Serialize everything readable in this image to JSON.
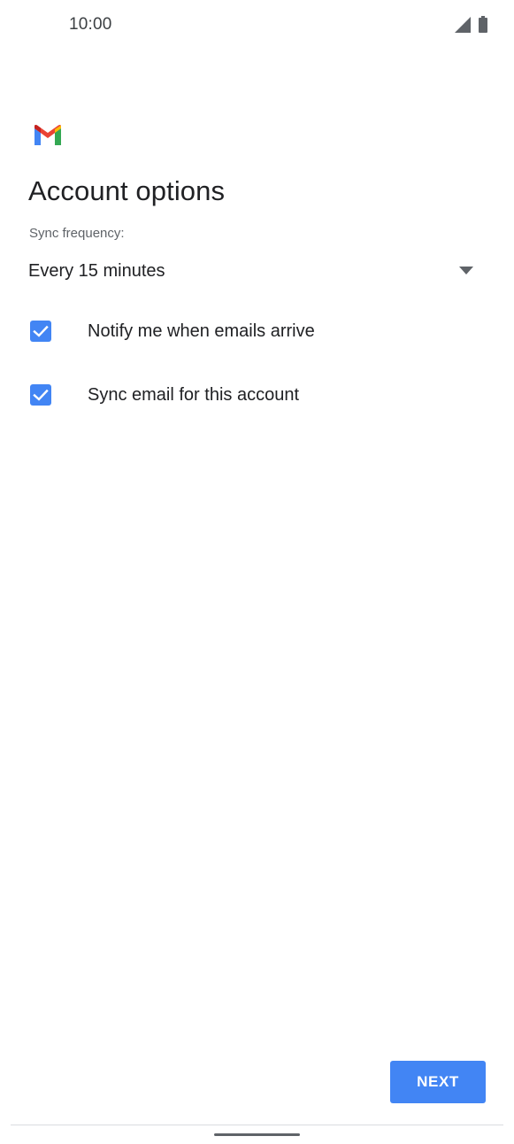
{
  "status_bar": {
    "time": "10:00",
    "icons": [
      "signal-icon",
      "battery-icon"
    ]
  },
  "header": {
    "logo_icon": "gmail-logo-icon",
    "title": "Account options"
  },
  "sync": {
    "label": "Sync frequency:",
    "selected": "Every 15 minutes"
  },
  "options": [
    {
      "label": "Notify me when emails arrive",
      "checked": true
    },
    {
      "label": "Sync email for this account",
      "checked": true
    }
  ],
  "actions": {
    "next_label": "NEXT"
  },
  "colors": {
    "accent": "#4285f4",
    "checkbox": "#4285f4",
    "text_primary": "#202124",
    "text_secondary": "#5f6368",
    "gmail_red": "#ea4335",
    "gmail_blue": "#4285f4",
    "gmail_green": "#34a853",
    "gmail_yellow": "#fbbc04",
    "gmail_dark_red": "#c5221f"
  }
}
